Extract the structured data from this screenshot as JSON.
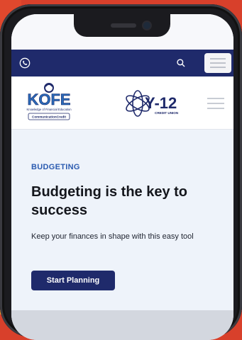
{
  "colors": {
    "navy": "#1f2a6b",
    "accent_blue": "#2b5bb0",
    "background": "#eef3fa",
    "backdrop_red": "#d8402b"
  },
  "topbar": {
    "left_icon": "phone-icon",
    "search_icon": "search-icon",
    "menu_icon": "hamburger-icon"
  },
  "logos": {
    "kofe_name": "KOFE",
    "kofe_tagline": "Knowledge of Financial Education",
    "kofe_partner": "CommunicationCredit",
    "y12_name": "Y-12",
    "y12_sub": "CREDIT UNION"
  },
  "hero": {
    "eyebrow": "BUDGETING",
    "headline": "Budgeting is the key to success",
    "description": "Keep your finances in shape with this easy tool",
    "cta_label": "Start Planning"
  }
}
